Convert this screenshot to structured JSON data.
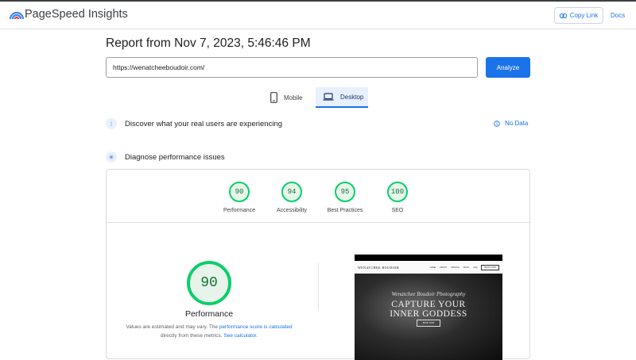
{
  "header": {
    "brand": "PageSpeed Insights",
    "copy_link": "Copy Link",
    "docs": "Docs"
  },
  "report": {
    "title": "Report from Nov 7, 2023, 5:46:46 PM",
    "url": "https://wenatcheeboudoir.com/",
    "analyze": "Analyze"
  },
  "tabs": [
    {
      "label": "Mobile",
      "icon": "phone-icon",
      "selected": false
    },
    {
      "label": "Desktop",
      "icon": "laptop-icon",
      "selected": true
    }
  ],
  "sections": {
    "discover": "Discover what your real users are experiencing",
    "no_data": "No Data",
    "diagnose": "Diagnose performance issues"
  },
  "scores": [
    {
      "label": "Performance",
      "value": "90"
    },
    {
      "label": "Accessibility",
      "value": "94"
    },
    {
      "label": "Best Practices",
      "value": "95"
    },
    {
      "label": "SEO",
      "value": "100"
    }
  ],
  "performance": {
    "value": "90",
    "label": "Performance",
    "note_1": "Values are estimated and may vary. The ",
    "note_link_1": "performance score is calculated",
    "note_2": "directly from these metrics. ",
    "note_link_2": "See calculator."
  },
  "screenshot": {
    "brand": "WENATCHEE BOUDOIR",
    "menu": [
      "HOME",
      "ABOUT",
      "PRICING",
      "BLOG",
      "FAQ"
    ],
    "book": "BOOK NOW",
    "script": "Wenatchee Boudoir Photography",
    "headline_1": "CAPTURE YOUR",
    "headline_2": "INNER GODDESS",
    "cta": "BOOK NOW"
  },
  "colors": {
    "accent": "#1a73e8",
    "pass": "#0cce6b"
  }
}
